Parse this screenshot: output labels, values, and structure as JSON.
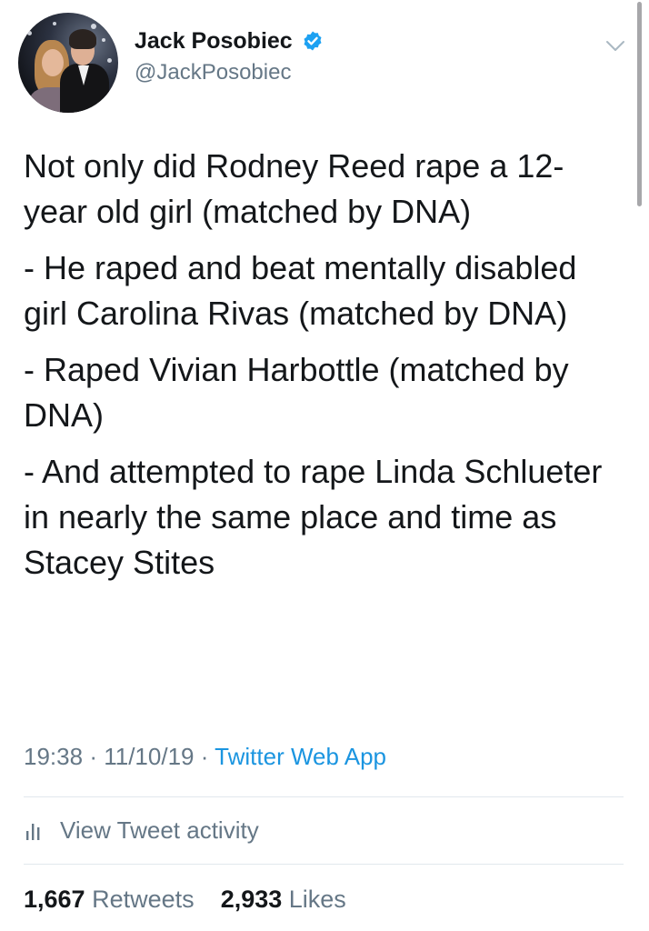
{
  "tweet": {
    "author": {
      "display_name": "Jack Posobiec",
      "handle": "@JackPosobiec",
      "verified": true,
      "avatar_icon": "profile-photo-couple"
    },
    "paragraphs": [
      "Not only did Rodney Reed rape a 12-year old girl (matched by DNA)",
      "- He raped and beat mentally disabled girl Carolina Rivas (matched by DNA)",
      "- Raped Vivian Harbottle (matched by DNA)",
      "- And attempted to rape Linda Schlueter in nearly the same place and time as Stacey Stites"
    ],
    "time": "19:38",
    "date": "11/10/19",
    "separator": "·",
    "source": "Twitter Web App",
    "activity_label": "View Tweet activity",
    "retweets_count": "1,667",
    "retweets_label": "Retweets",
    "likes_count": "2,933",
    "likes_label": "Likes"
  },
  "colors": {
    "text": "#14171a",
    "secondary": "#657786",
    "link": "#1b95e0",
    "verified": "#1da1f2",
    "divider": "#e1e8ed"
  },
  "icons": [
    "verified-badge-icon",
    "chevron-down-icon",
    "bar-chart-icon"
  ]
}
